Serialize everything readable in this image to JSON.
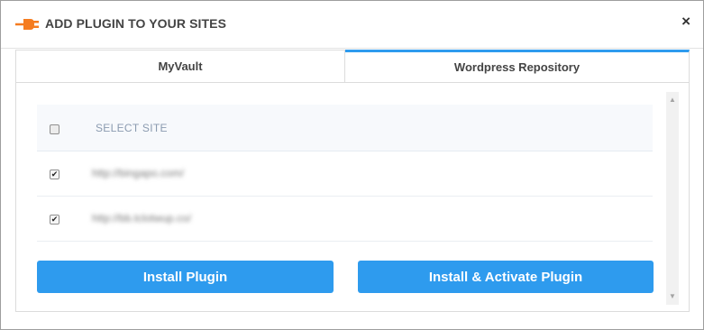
{
  "dialog": {
    "title": "ADD PLUGIN TO YOUR SITES",
    "close_label": "×",
    "icon": "plug-icon",
    "accent_color": "#2e9bee",
    "icon_color": "#f57c20"
  },
  "tabs": [
    {
      "label": "MyVault",
      "active": false
    },
    {
      "label": "Wordpress Repository",
      "active": true
    }
  ],
  "table": {
    "header_label": "SELECT SITE",
    "header_checked": false,
    "rows": [
      {
        "url": "http://bingapo.com/",
        "checked": true
      },
      {
        "url": "http://bb.tclotwup.co/",
        "checked": true
      }
    ]
  },
  "buttons": {
    "install": "Install Plugin",
    "install_activate": "Install & Activate Plugin"
  },
  "scrollbar": {
    "up_icon": "▲",
    "down_icon": "▼"
  }
}
